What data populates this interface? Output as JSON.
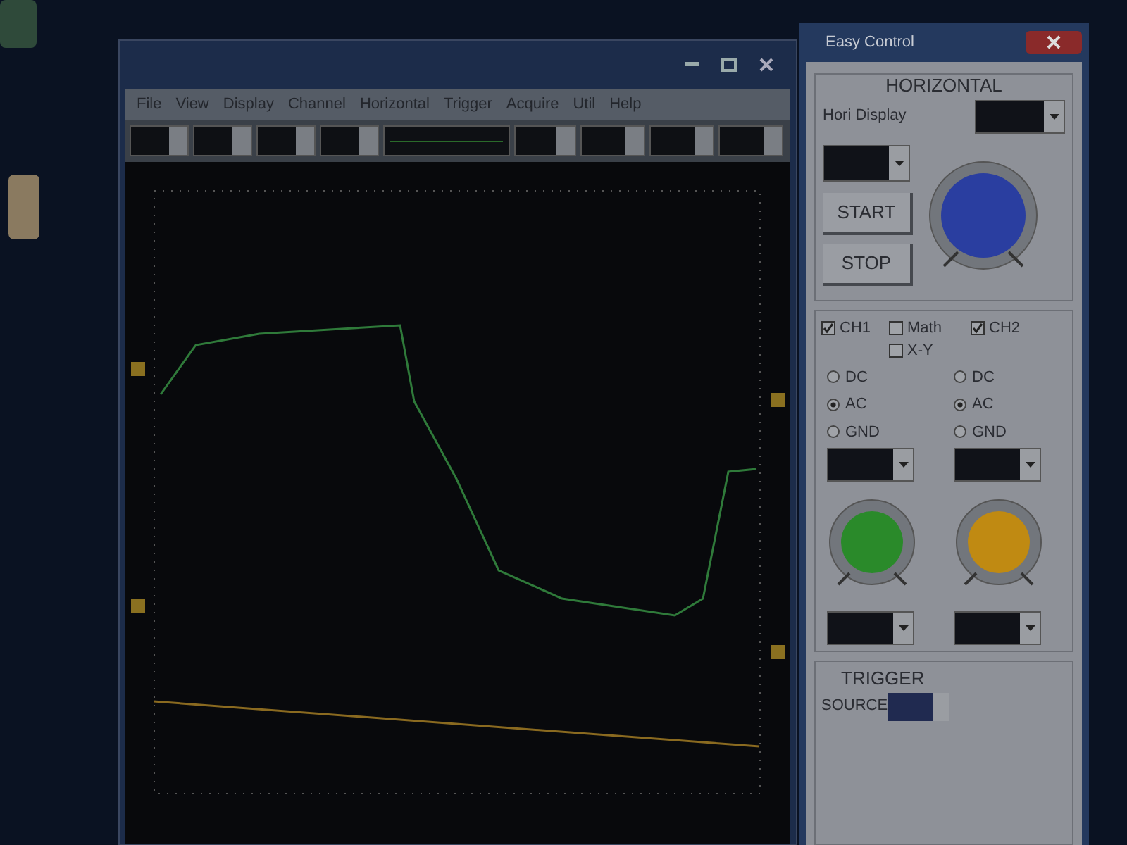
{
  "scope_window": {
    "menu": [
      "File",
      "View",
      "Display",
      "Channel",
      "Horizontal",
      "Trigger",
      "Acquire",
      "Util",
      "Help"
    ]
  },
  "easy_control": {
    "title": "Easy Control",
    "horizontal": {
      "heading": "HORIZONTAL",
      "hori_display_label": "Hori Display",
      "buttons": [
        "START",
        "STOP"
      ]
    },
    "toggles": [
      {
        "label": "CH1",
        "checked": true
      },
      {
        "label": "Math",
        "checked": false
      },
      {
        "label": "X-Y",
        "checked": false
      },
      {
        "label": "CH2",
        "checked": true
      }
    ],
    "channels": [
      {
        "color": "#2a8a2a",
        "couplings": [
          {
            "label": "DC",
            "selected": false
          },
          {
            "label": "AC",
            "selected": true
          },
          {
            "label": "GND",
            "selected": false
          }
        ]
      },
      {
        "color": "#c08a12",
        "couplings": [
          {
            "label": "DC",
            "selected": false
          },
          {
            "label": "AC",
            "selected": true
          },
          {
            "label": "GND",
            "selected": false
          }
        ]
      }
    ],
    "trigger": {
      "heading": "TRIGGER",
      "source_label": "SOURCE"
    }
  }
}
